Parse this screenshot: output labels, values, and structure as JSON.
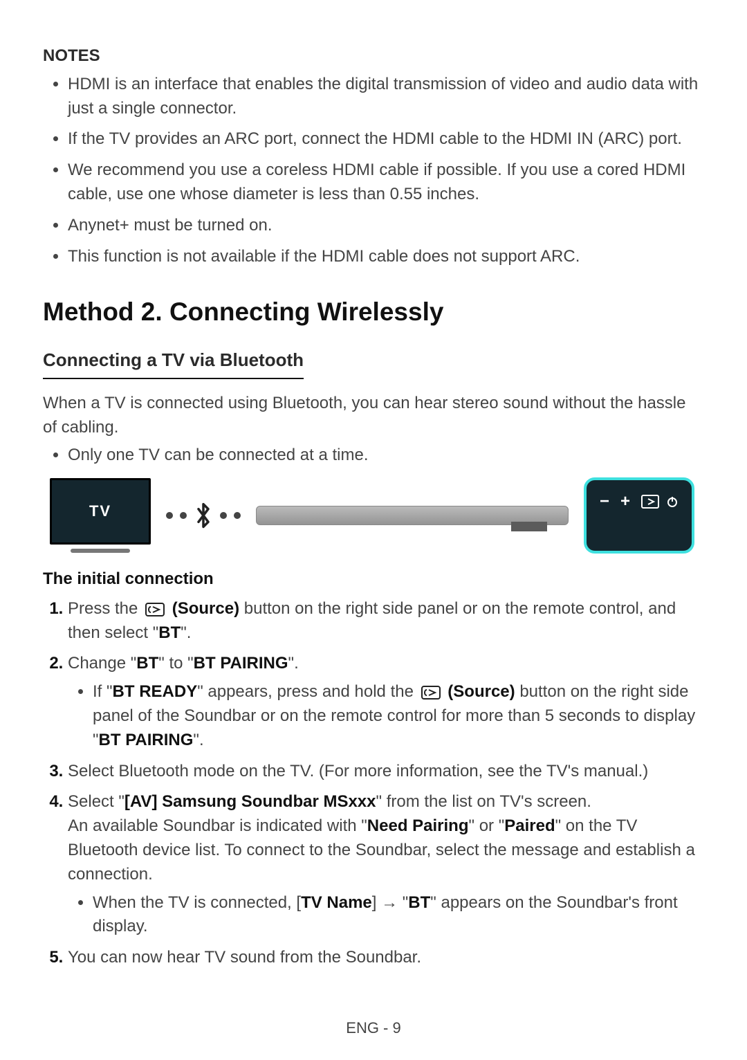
{
  "notes": {
    "label": "NOTES",
    "items": [
      "HDMI is an interface that enables the digital transmission of video and audio data with just a single connector.",
      "If the TV provides an ARC port, connect the HDMI cable to the HDMI IN (ARC) port.",
      "We recommend you use a coreless HDMI cable if possible. If you use a cored HDMI cable, use one whose diameter is less than 0.55 inches.",
      "Anynet+ must be turned on.",
      "This function is not available if the HDMI cable does not support ARC."
    ]
  },
  "method": {
    "title": "Method 2. Connecting Wirelessly"
  },
  "bluetooth": {
    "title": "Connecting a TV via Bluetooth",
    "lead": "When a TV is connected using Bluetooth, you can hear stereo sound without the hassle of cabling.",
    "note": "Only one TV can be connected at a time."
  },
  "diagram": {
    "tv_label": "TV",
    "panel_minus": "−",
    "panel_plus": "+"
  },
  "initial": {
    "title": "The initial connection",
    "step1_a": "Press the ",
    "step1_b": " (Source)",
    "step1_c": " button on the right side panel or on the remote control, and then select \"",
    "step1_bt": "BT",
    "step1_d": "\".",
    "step2_a": "Change \"",
    "step2_bt": "BT",
    "step2_b": "\" to \"",
    "step2_pair": "BT PAIRING",
    "step2_c": "\".",
    "step2_sub_a": "If \"",
    "step2_sub_ready": "BT READY",
    "step2_sub_b": "\" appears, press and hold the ",
    "step2_sub_c": " (Source)",
    "step2_sub_d": " button on the right side panel of the Soundbar or on the remote control for more than 5 seconds to display \"",
    "step2_sub_pair": "BT PAIRING",
    "step2_sub_e": "\".",
    "step3": "Select Bluetooth mode on the TV. (For more information, see the TV's manual.)",
    "step4_a": "Select \"",
    "step4_model": "[AV] Samsung Soundbar MSxxx",
    "step4_b": "\" from the list on TV's screen.",
    "step4_c_a": "An available Soundbar is indicated with \"",
    "step4_need": "Need Pairing",
    "step4_c_b": "\" or \"",
    "step4_paired": "Paired",
    "step4_c_c": "\" on the TV Bluetooth device list. To connect to the Soundbar, select the message and establish a connection.",
    "step4_sub_a": "When the TV is connected, [",
    "step4_sub_tvname": "TV Name",
    "step4_sub_b": "] → \"",
    "step4_sub_bt": "BT",
    "step4_sub_c": "\" appears on the Soundbar's front display.",
    "step5": "You can now hear TV sound from the Soundbar."
  },
  "footer": {
    "page": "ENG - 9"
  }
}
